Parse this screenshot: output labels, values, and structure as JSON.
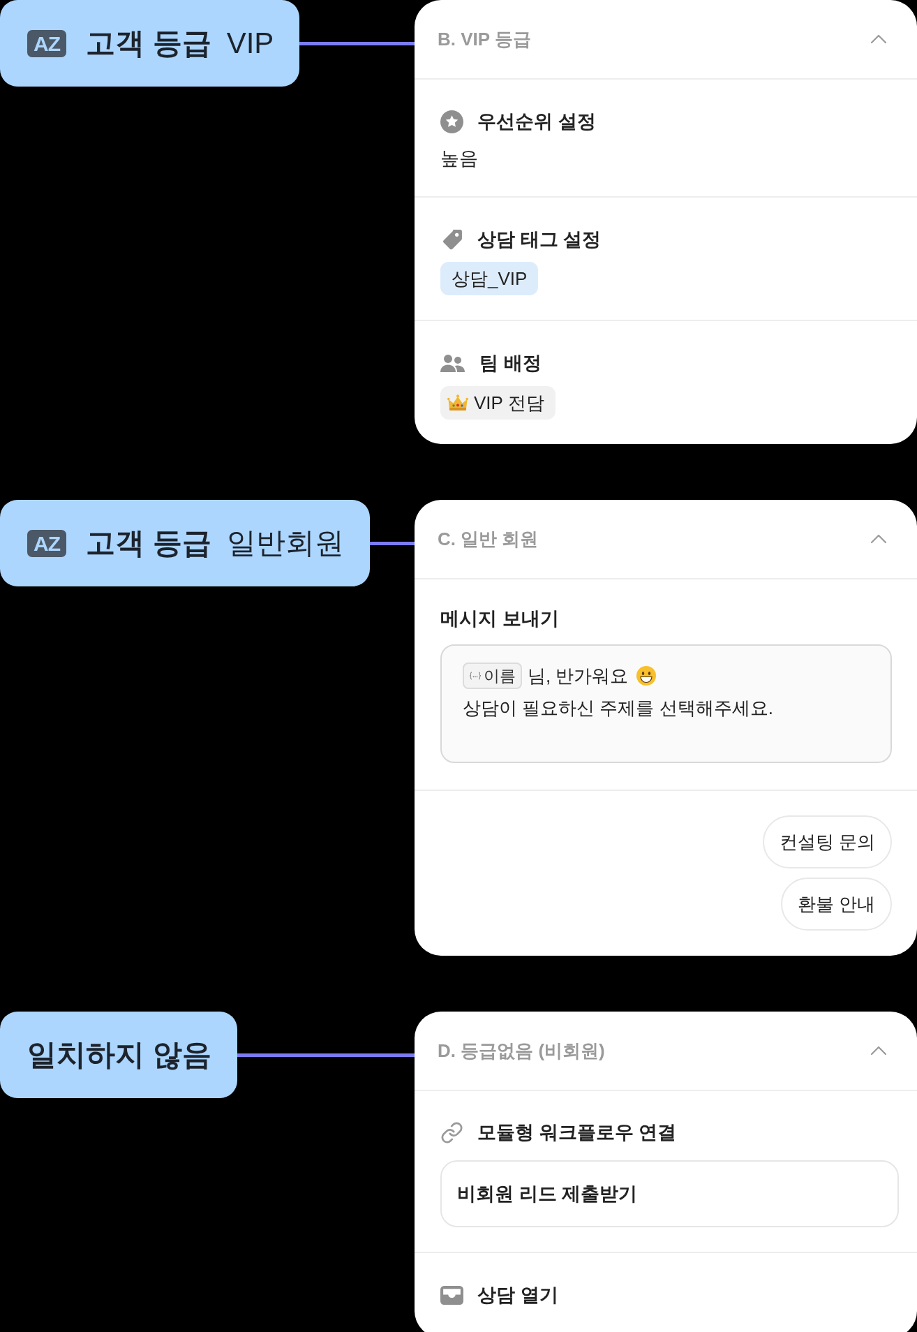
{
  "branches": [
    {
      "condition": {
        "kind": "attribute",
        "badge": "AZ",
        "attribute": "고객 등급",
        "value": "VIP"
      },
      "card": {
        "title": "B. VIP 등급",
        "expanded": true,
        "sections": [
          {
            "kind": "priority",
            "title": "우선순위 설정",
            "value": "높음"
          },
          {
            "kind": "tag",
            "title": "상담 태그 설정",
            "tags": [
              "상담_VIP"
            ]
          },
          {
            "kind": "team",
            "title": "팀 배정",
            "team": "VIP 전담"
          }
        ]
      }
    },
    {
      "condition": {
        "kind": "attribute",
        "badge": "AZ",
        "attribute": "고객 등급",
        "value": "일반회원"
      },
      "card": {
        "title": "C. 일반 회원",
        "expanded": true,
        "sections": [
          {
            "kind": "message",
            "title": "메시지 보내기",
            "lines": [
              {
                "parts": [
                  {
                    "kind": "variable",
                    "text": "이름"
                  },
                  {
                    "kind": "text",
                    "text": "님, 반가워요"
                  },
                  {
                    "kind": "smiley"
                  }
                ]
              },
              {
                "parts": [
                  {
                    "kind": "text",
                    "text": "상담이 필요하신 주제를 선택해주세요."
                  }
                ]
              }
            ]
          },
          {
            "kind": "buttons",
            "buttons": [
              "컨설팅 문의",
              "환불 안내"
            ]
          }
        ]
      }
    },
    {
      "condition": {
        "kind": "fallback",
        "text": "일치하지 않음"
      },
      "card": {
        "title": "D. 등급없음 (비회원)",
        "expanded": true,
        "sections": [
          {
            "kind": "workflow",
            "title": "모듈형 워크플로우 연결",
            "workflow": "비회원 리드 제출받기"
          },
          {
            "kind": "open_chat",
            "title": "상담 열기"
          }
        ]
      }
    }
  ]
}
